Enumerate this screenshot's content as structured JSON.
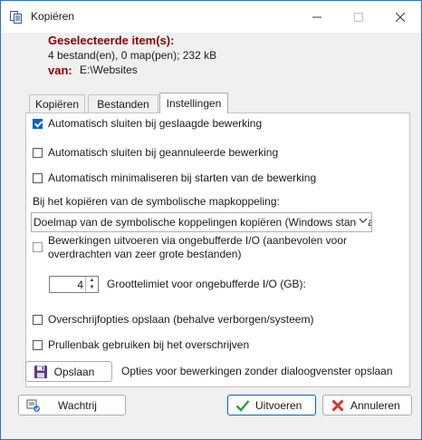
{
  "window": {
    "title": "Kopiëren",
    "controls": {
      "minimize": "—",
      "maximize": "☐",
      "close": "✕"
    }
  },
  "header": {
    "selected_label": "Geselecteerde item(s):",
    "selected_value": "4 bestand(en), 0 map(pen);   232 kB",
    "from_label": "van:",
    "from_value": "E:\\Websites"
  },
  "tabs": [
    {
      "label": "Kopiëren",
      "active": false
    },
    {
      "label": "Bestanden",
      "active": false
    },
    {
      "label": "Instellingen",
      "active": true
    }
  ],
  "settings": {
    "auto_close_success": {
      "label": "Automatisch sluiten bij geslaagde bewerking",
      "checked": true
    },
    "auto_close_cancel": {
      "label": "Automatisch sluiten bij geannuleerde bewerking",
      "checked": false
    },
    "auto_minimize": {
      "label": "Automatisch minimaliseren bij starten van de bewerking",
      "checked": false
    },
    "symlink_label": "Bij het kopiëren van de symbolische mapkoppeling:",
    "symlink_select_value": "Doelmap van de symbolische koppelingen kopiëren (Windows standaard)",
    "unbuffered": {
      "label": "Bewerkingen uitvoeren via ongebufferde I/O (aanbevolen voor overdrachten van zeer grote bestanden)",
      "checked": false
    },
    "buffer_limit_value": "4",
    "buffer_limit_label": "Grootte­limiet voor ongebufferde I/O (GB):",
    "save_overwrite": {
      "label": "Overschrijfopties opslaan (behalve verborgen/systeem)",
      "checked": false
    },
    "recycle_bin": {
      "label": "Prullenbak gebruiken bij het overschrijven",
      "checked": false
    },
    "save_button_label": "Opslaan",
    "save_note": "Opties voor bewerkingen zonder dialoogvenster opslaan"
  },
  "footer": {
    "queue_label": "Wachtrij",
    "execute_label": "Uitvoeren",
    "cancel_label": "Annuleren"
  },
  "colors": {
    "accent": "#0060c0",
    "header_label": "#8b0000",
    "check_green": "#2e9d4f",
    "cancel_red": "#d9302b"
  }
}
